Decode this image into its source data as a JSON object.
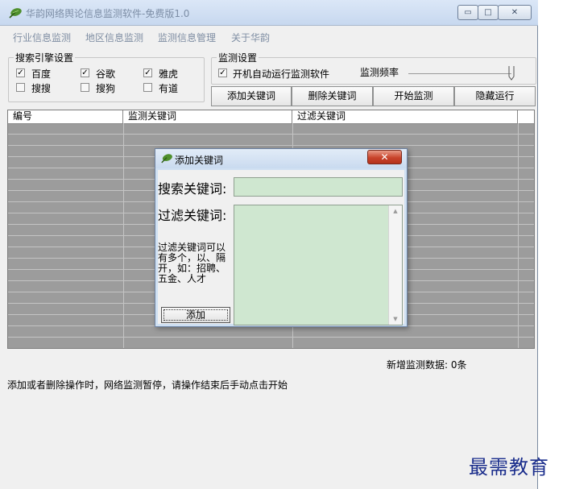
{
  "window": {
    "title": "华韵网络舆论信息监测软件-免费版1.0",
    "caption_buttons": {
      "minimize": "▭",
      "maximize": "□",
      "close": "✕"
    }
  },
  "menu": [
    "行业信息监测",
    "地区信息监测",
    "监测信息管理",
    "关于华韵"
  ],
  "search_engines": {
    "title": "搜索引擎设置",
    "items": [
      {
        "label": "百度",
        "checked": "✓"
      },
      {
        "label": "谷歌",
        "checked": "✓"
      },
      {
        "label": "雅虎",
        "checked": "✓"
      },
      {
        "label": "搜搜",
        "checked": ""
      },
      {
        "label": "搜狗",
        "checked": ""
      },
      {
        "label": "有道",
        "checked": ""
      }
    ]
  },
  "monitor_settings": {
    "title": "监测设置",
    "autorun_label": "开机自动运行监测软件",
    "autorun_checked": "✓",
    "frequency_label": "监测频率",
    "frequency_level": 1.0
  },
  "toolbar": {
    "add_keyword": "添加关键词",
    "delete_keyword": "删除关键词",
    "start_monitor": "开始监测",
    "hide_run": "隐藏运行"
  },
  "table": {
    "columns": [
      "编号",
      "监测关键词",
      "过滤关键词"
    ]
  },
  "stats": {
    "new_data": "新增监测数据: 0条"
  },
  "notice": "添加或者删除操作时，网络监测暂停，请操作结束后手动点击开始",
  "dialog": {
    "title": "添加关键词",
    "close": "✕",
    "search_label": "搜索关键词:",
    "filter_label": "过滤关键词:",
    "hint": "过滤关键词可以有多个，以、隔开，如：招聘、五金、人才",
    "add_button": "添加",
    "scroll_up": "▲",
    "scroll_down": "▼"
  },
  "watermark": "最需教育",
  "colors": {
    "grid_gray": "#9c9c9c",
    "input_green": "#cfe7d0",
    "title_gray": "#7d8ea6"
  }
}
